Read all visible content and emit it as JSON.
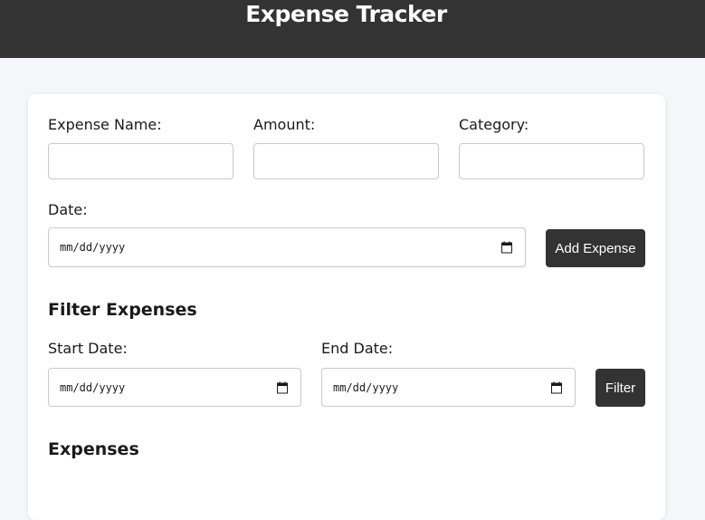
{
  "header": {
    "title": "Expense Tracker"
  },
  "form": {
    "expense_name_label": "Expense Name:",
    "expense_name_value": "",
    "amount_label": "Amount:",
    "amount_value": "",
    "category_label": "Category:",
    "category_value": "",
    "date_label": "Date:",
    "date_placeholder": "mm/dd/yyyy",
    "add_button": "Add Expense"
  },
  "filter": {
    "title": "Filter Expenses",
    "start_label": "Start Date:",
    "start_placeholder": "mm/dd/yyyy",
    "end_label": "End Date:",
    "end_placeholder": "mm/dd/yyyy",
    "filter_button": "Filter"
  },
  "expenses": {
    "title": "Expenses"
  },
  "icons": {
    "calendar": "calendar-icon"
  },
  "colors": {
    "header_bg": "#333333",
    "button_bg": "#333333",
    "page_bg": "#f4f6f8"
  }
}
